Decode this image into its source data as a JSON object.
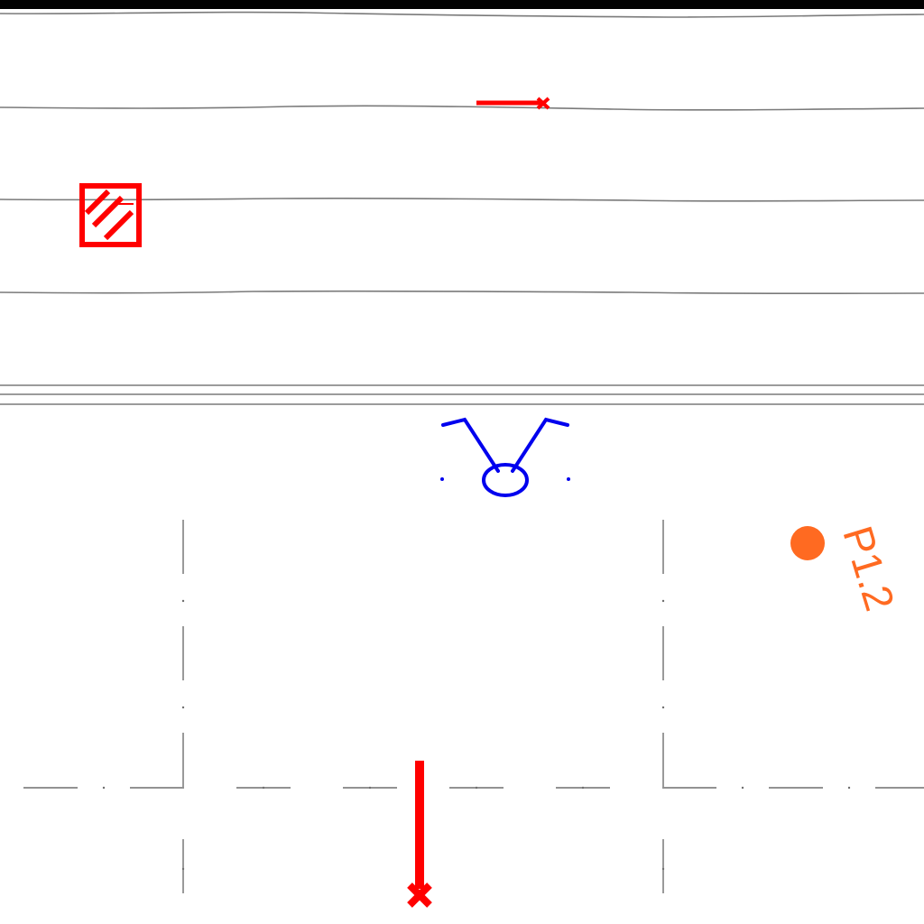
{
  "drawing": {
    "point_label": "P1.2",
    "colors": {
      "background": "#ffffff",
      "frame_border": "#000000",
      "contour_line": "#7a7a7a",
      "axis_line": "#6e6e6e",
      "hazard_symbol": "#ff0000",
      "fixture_symbol": "#0000ee",
      "survey_point": "#ff6a21"
    },
    "icons": {
      "hatched_box": "hatched-square-icon",
      "short_pin": "x-pin-icon",
      "long_pin": "x-pin-icon",
      "fixture": "fixture-symbol-icon",
      "survey_point": "dot-icon"
    }
  }
}
